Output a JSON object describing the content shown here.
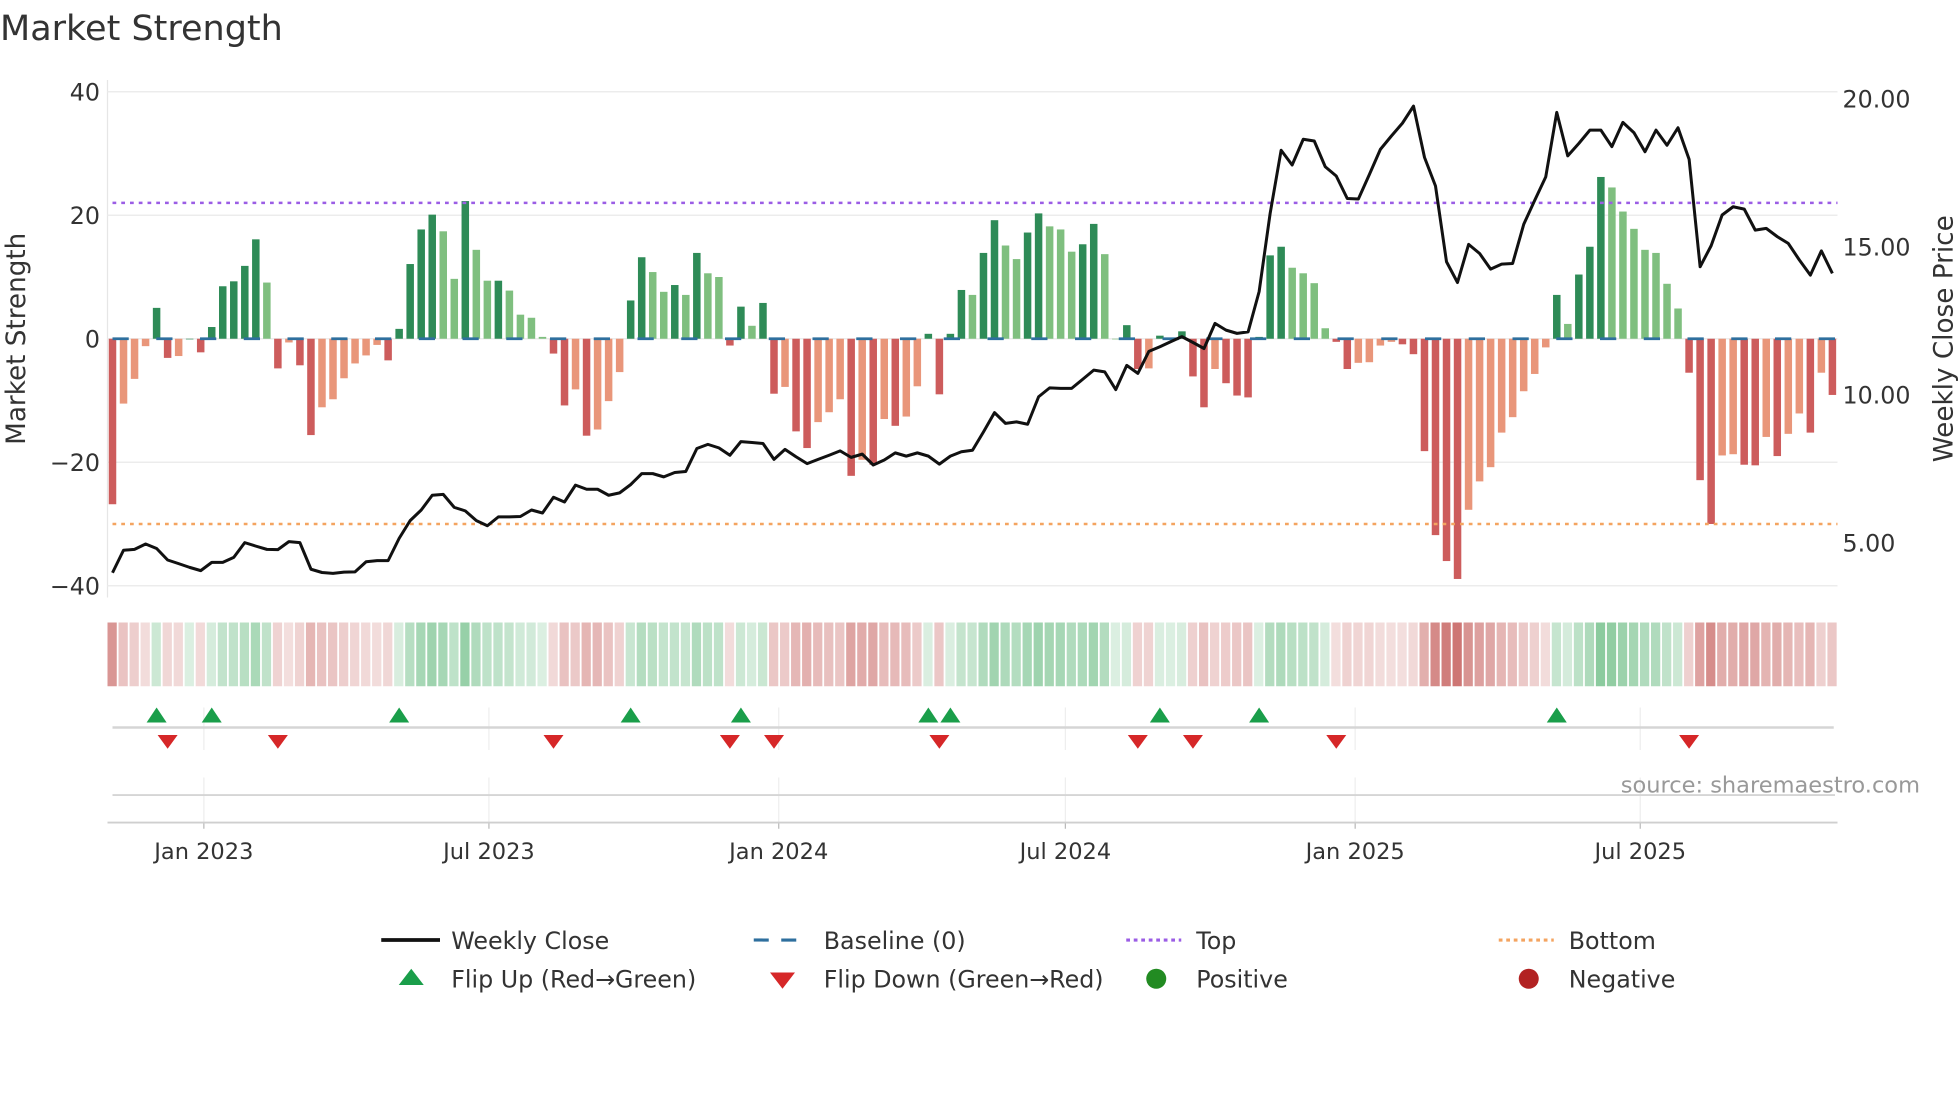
{
  "chart_data": {
    "type": "bar",
    "title": "Market Strength",
    "ylabel": "Market Strength",
    "y2label": "Weekly Close Price",
    "ylim": [
      -42,
      42
    ],
    "y2lim": [
      2.8,
      20.6
    ],
    "grid": true,
    "start_date": "2022-11-04",
    "step_days": 7,
    "left_ticks": [
      {
        "v": 40,
        "label": "40"
      },
      {
        "v": 20,
        "label": "20"
      },
      {
        "v": 0,
        "label": "0"
      },
      {
        "v": -20,
        "label": "−20"
      },
      {
        "v": -40,
        "label": "−40"
      }
    ],
    "right_ticks": [
      {
        "v": 20,
        "label": "20.00"
      },
      {
        "v": 15,
        "label": "15.00"
      },
      {
        "v": 10,
        "label": "10.00"
      },
      {
        "v": 5,
        "label": "5.00"
      }
    ],
    "x_ticks": [
      {
        "date": "2023-01-01",
        "label": "Jan 2023"
      },
      {
        "date": "2023-07-01",
        "label": "Jul 2023"
      },
      {
        "date": "2024-01-01",
        "label": "Jan 2024"
      },
      {
        "date": "2024-07-01",
        "label": "Jul 2024"
      },
      {
        "date": "2025-01-01",
        "label": "Jan 2025"
      },
      {
        "date": "2025-07-01",
        "label": "Jul 2025"
      }
    ],
    "top_level": 22,
    "bottom_level": -30,
    "baseline": 0,
    "strength": [
      -26.8,
      -10.5,
      -6.5,
      -1.2,
      5,
      -3.1,
      -2.8,
      0,
      -2.2,
      1.9,
      8.5,
      9.3,
      11.8,
      16.1,
      9.1,
      -4.8,
      -0.6,
      -4.3,
      -15.6,
      -11.1,
      -9.8,
      -6.4,
      -4.0,
      -2.7,
      -1.0,
      -3.5,
      1.6,
      12.1,
      17.7,
      20.1,
      17.4,
      9.7,
      22.3,
      14.4,
      9.4,
      9.4,
      7.8,
      3.9,
      3.4,
      0.3,
      -2.4,
      -10.8,
      -8.2,
      -15.7,
      -14.7,
      -10.1,
      -5.4,
      6.2,
      13.2,
      10.8,
      7.6,
      8.7,
      7.1,
      13.9,
      10.6,
      10.0,
      -1.1,
      5.2,
      2.1,
      5.8,
      -8.9,
      -7.8,
      -15,
      -17.7,
      -13.5,
      -11.9,
      -9.8,
      -22.2,
      -19.6,
      -20.4,
      -13.0,
      -14.1,
      -12.6,
      -7.7,
      0.8,
      -9.0,
      0.8,
      7.9,
      7.1,
      13.9,
      19.2,
      15.1,
      12.9,
      17.2,
      20.3,
      18.2,
      17.7,
      14.1,
      15.3,
      18.6,
      13.7,
      0,
      2.2,
      -4.9,
      -4.8,
      0.5,
      0,
      1.2,
      -6.1,
      -11.1,
      -4.9,
      -7.2,
      -9.2,
      -9.5,
      0.3,
      13.5,
      14.9,
      11.5,
      10.6,
      9.0,
      1.7,
      -0.5,
      -4.9,
      -3.9,
      -3.8,
      -1.1,
      -0.5,
      -0.9,
      -2.5,
      -18.2,
      -31.8,
      -36,
      -38.9,
      -27.7,
      -23.1,
      -20.8,
      -15.2,
      -12.7,
      -8.5,
      -5.7,
      -1.4,
      7.1,
      2.4,
      10.4,
      14.9,
      26.2,
      24.5,
      20.6,
      17.8,
      14.4,
      13.9,
      8.9,
      4.9,
      -5.5,
      -22.9,
      -30,
      -18.9,
      -18.7,
      -20.4,
      -20.5,
      -15.9,
      -19.0,
      -15.4,
      -12.1,
      -15.2,
      -5.5,
      -9.1
    ],
    "weekly_close": [
      3.98,
      4.74,
      4.77,
      4.95,
      4.8,
      4.41,
      4.29,
      4.16,
      4.05,
      4.33,
      4.33,
      4.5,
      5.0,
      4.88,
      4.77,
      4.76,
      5.03,
      5.0,
      4.1,
      3.99,
      3.96,
      4.0,
      4.01,
      4.35,
      4.39,
      4.39,
      5.14,
      5.74,
      6.1,
      6.6,
      6.63,
      6.19,
      6.07,
      5.74,
      5.57,
      5.87,
      5.87,
      5.88,
      6.1,
      6.0,
      6.53,
      6.37,
      6.94,
      6.8,
      6.8,
      6.6,
      6.68,
      6.96,
      7.33,
      7.33,
      7.22,
      7.37,
      7.4,
      8.18,
      8.32,
      8.2,
      7.95,
      8.41,
      8.38,
      8.35,
      7.81,
      8.15,
      7.9,
      7.67,
      7.81,
      7.95,
      8.1,
      7.88,
      7.99,
      7.62,
      7.79,
      8.03,
      7.92,
      8.03,
      7.92,
      7.65,
      7.92,
      8.07,
      8.12,
      8.74,
      9.39,
      9.03,
      9.08,
      9.0,
      9.93,
      10.23,
      10.21,
      10.21,
      10.52,
      10.83,
      10.77,
      10.17,
      10.99,
      10.72,
      11.46,
      11.62,
      11.79,
      11.96,
      11.76,
      11.56,
      12.41,
      12.18,
      12.07,
      12.12,
      13.48,
      16.12,
      18.26,
      17.76,
      18.63,
      18.57,
      17.7,
      17.39,
      16.63,
      16.61,
      17.44,
      18.29,
      18.74,
      19.17,
      19.75,
      18.02,
      17.05,
      14.49,
      13.79,
      15.08,
      14.77,
      14.24,
      14.41,
      14.43,
      15.76,
      16.57,
      17.36,
      19.54,
      18.07,
      18.49,
      18.94,
      18.94,
      18.38,
      19.2,
      18.85,
      18.21,
      18.94,
      18.43,
      19.02,
      17.95,
      14.32,
      15.03,
      16.07,
      16.35,
      16.27,
      15.56,
      15.62,
      15.34,
      15.11,
      14.55,
      14.04,
      14.86,
      14.1
    ],
    "flip_up_weeks": [
      5,
      10,
      27,
      48,
      58,
      75,
      77,
      96,
      105,
      132
    ],
    "flip_down_weeks": [
      6,
      16,
      41,
      57,
      61,
      76,
      94,
      99,
      112,
      144
    ],
    "legend": {
      "placement": "bottom",
      "items": [
        {
          "key": "close",
          "label": "Weekly Close"
        },
        {
          "key": "baseline",
          "label": "Baseline (0)"
        },
        {
          "key": "top",
          "label": "Top"
        },
        {
          "key": "bottom",
          "label": "Bottom"
        },
        {
          "key": "flip_up",
          "label": "Flip Up (Red→Green)"
        },
        {
          "key": "flip_down",
          "label": "Flip Down (Green→Red)"
        },
        {
          "key": "positive",
          "label": "Positive"
        },
        {
          "key": "negative",
          "label": "Negative"
        }
      ]
    },
    "source": "source: sharemaestro.com"
  },
  "colors": {
    "pos_strong": "#2e8b57",
    "pos_weak": "#7fbf7f",
    "neg_strong": "#cd5c5c",
    "neg_weak": "#e9967a",
    "close": "#111111",
    "baseline": "#2e6f9e",
    "top": "#9b5de5",
    "bottom": "#f4a460",
    "flip_up": "#1a9e4a",
    "flip_down": "#d62728",
    "positive": "#228b22",
    "negative": "#b22222",
    "strip_pos": "#3aa65a",
    "strip_neg": "#c0504d"
  }
}
